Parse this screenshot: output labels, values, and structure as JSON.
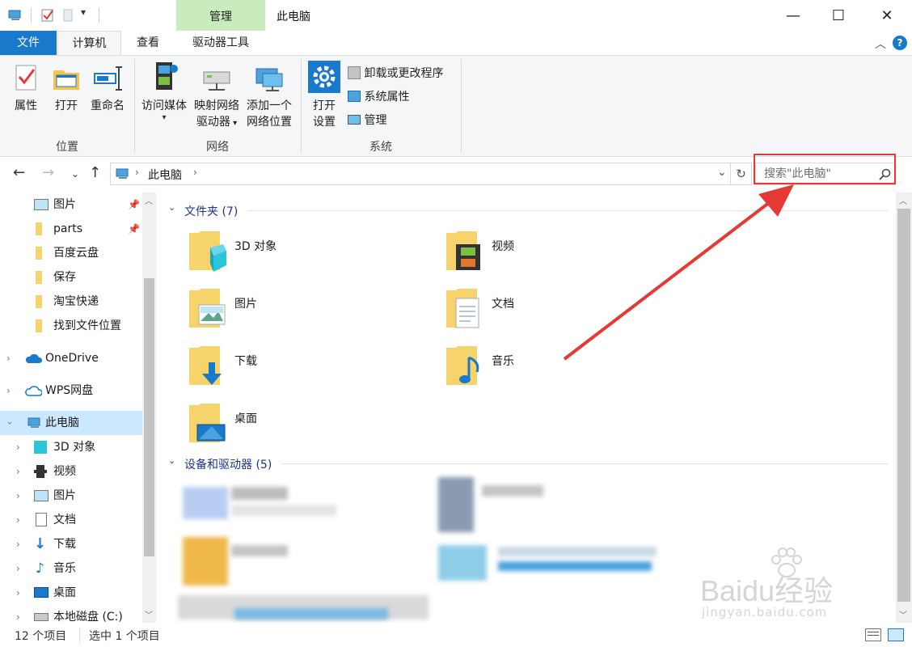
{
  "window": {
    "title": "此电脑",
    "context_tab": "管理",
    "minimize": "—",
    "maximize": "☐",
    "close": "✕"
  },
  "tabs": [
    {
      "label": "文件"
    },
    {
      "label": "计算机"
    },
    {
      "label": "查看"
    },
    {
      "label": "驱动器工具"
    }
  ],
  "ribbon": {
    "location": {
      "group": "位置",
      "properties": "属性",
      "open": "打开",
      "rename": "重命名"
    },
    "network": {
      "group": "网络",
      "media_line1": "访问媒体",
      "map_line1": "映射网络",
      "map_line2": "驱动器",
      "add_line1": "添加一个",
      "add_line2": "网络位置"
    },
    "system": {
      "group": "系统",
      "settings_line1": "打开",
      "settings_line2": "设置",
      "uninstall": "卸载或更改程序",
      "sysprops": "系统属性",
      "manage": "管理"
    }
  },
  "address": {
    "crumb": "此电脑",
    "search_placeholder": "搜索\"此电脑\""
  },
  "nav": {
    "quick": [
      "图片",
      "parts",
      "百度云盘",
      "保存",
      "淘宝快递",
      "找到文件位置"
    ],
    "onedrive": "OneDrive",
    "wps": "WPS网盘",
    "thispc": "此电脑",
    "children": [
      "3D 对象",
      "视频",
      "图片",
      "文档",
      "下载",
      "音乐",
      "桌面",
      "本地磁盘 (C:)"
    ]
  },
  "main": {
    "folders_header": "文件夹 (7)",
    "folders": [
      "3D 对象",
      "视频",
      "图片",
      "文档",
      "下载",
      "音乐",
      "桌面"
    ],
    "devices_header": "设备和驱动器 (5)"
  },
  "status": {
    "count": "12 个项目",
    "selected": "选中 1 个项目"
  },
  "watermark": {
    "brand": "Baidu经验",
    "url": "jingyan.baidu.com"
  },
  "colors": {
    "accent": "#1979ca",
    "ribbon_bg": "#f5f6f7",
    "context_tab": "#c9ecbe",
    "selection": "#cce8ff",
    "annotation": "#e53935",
    "folder": "#f7d46b",
    "section_header": "#1e3287"
  }
}
